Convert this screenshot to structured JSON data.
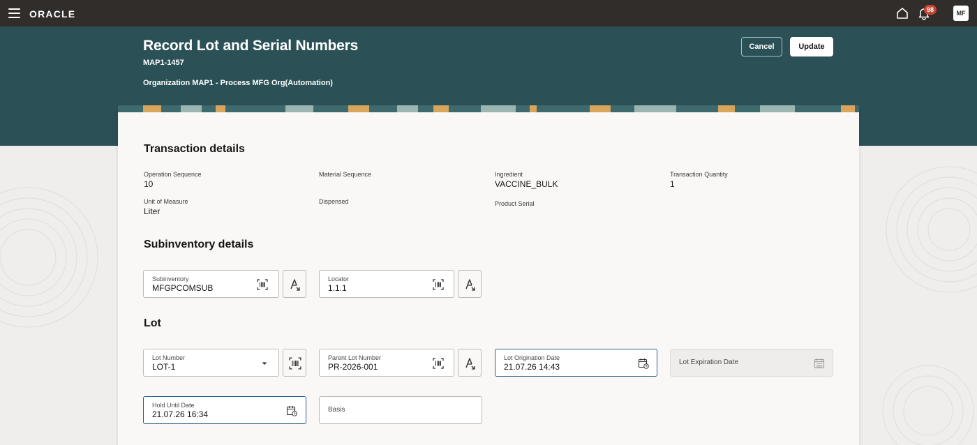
{
  "topbar": {
    "logo": "ORACLE",
    "notifications_count": "98",
    "avatar_initials": "MF",
    "icons": [
      "hamburger-menu-icon",
      "home-icon",
      "bell-icon"
    ]
  },
  "header": {
    "title": "Record Lot and Serial Numbers",
    "subtitle": "MAP1-1457",
    "organization": "Organization MAP1 - Process MFG Org(Automation)",
    "cancel_label": "Cancel",
    "update_label": "Update"
  },
  "transaction": {
    "section_title": "Transaction details",
    "operation_sequence": {
      "label": "Operation Sequence",
      "value": "10"
    },
    "material_sequence": {
      "label": "Material Sequence",
      "value": ""
    },
    "ingredient": {
      "label": "Ingredient",
      "value": "VACCINE_BULK"
    },
    "transaction_quantity": {
      "label": "Transaction Quantity",
      "value": "1"
    },
    "unit_of_measure": {
      "label": "Unit of Measure",
      "value": "Liter"
    },
    "dispensed": {
      "label": "Dispensed",
      "value": ""
    },
    "product_serial": {
      "label": "Product Serial",
      "value": ""
    }
  },
  "subinventory": {
    "section_title": "Subinventory details",
    "subinventory": {
      "label": "Subinventory",
      "value": "MFGPCOMSUB"
    },
    "locator": {
      "label": "Locator",
      "value": "1.1.1"
    }
  },
  "lot": {
    "section_title": "Lot",
    "lot_number": {
      "label": "Lot Number",
      "value": "LOT-1"
    },
    "parent_lot_number": {
      "label": "Parent Lot Number",
      "value": "PR-2026-001"
    },
    "lot_origination_date": {
      "label": "Lot Origination Date",
      "value": "21.07.26 14:43"
    },
    "lot_expiration_date": {
      "label": "Lot Expiration Date",
      "value": ""
    },
    "hold_until_date": {
      "label": "Hold Until Date",
      "value": "21.07.26 16:34"
    },
    "basis": {
      "label": "Basis",
      "value": ""
    }
  },
  "colors": {
    "topbar": "#312d2a",
    "header_band": "#2b5156",
    "notification_badge": "#c74634",
    "focus_border": "#2a5d86"
  }
}
